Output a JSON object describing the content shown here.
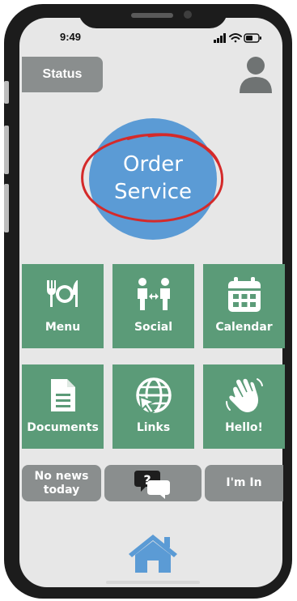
{
  "status_bar": {
    "time": "9:49"
  },
  "header": {
    "status_label": "Status"
  },
  "order_service": {
    "line1": "Order",
    "line2": "Service"
  },
  "tiles": [
    {
      "label": "Menu",
      "icon": "utensils-plate-icon"
    },
    {
      "label": "Social",
      "icon": "people-exchange-icon"
    },
    {
      "label": "Calendar",
      "icon": "calendar-icon"
    },
    {
      "label": "Documents",
      "icon": "document-icon"
    },
    {
      "label": "Links",
      "icon": "globe-cursor-icon"
    },
    {
      "label": "Hello!",
      "icon": "waving-hand-icon"
    }
  ],
  "bottom_row": {
    "news_label": "No news today",
    "news_line1": "No news",
    "news_line2": "today",
    "help_icon": "question-chat-icon",
    "im_in_label": "I'm In"
  },
  "nav": {
    "home_icon": "home-icon"
  },
  "colors": {
    "tile_green": "#5b9b78",
    "order_blue": "#5b9bd5",
    "button_gray": "#8a8e8e",
    "scribble_red": "#d42a2a",
    "background": "#e7e7e7"
  }
}
